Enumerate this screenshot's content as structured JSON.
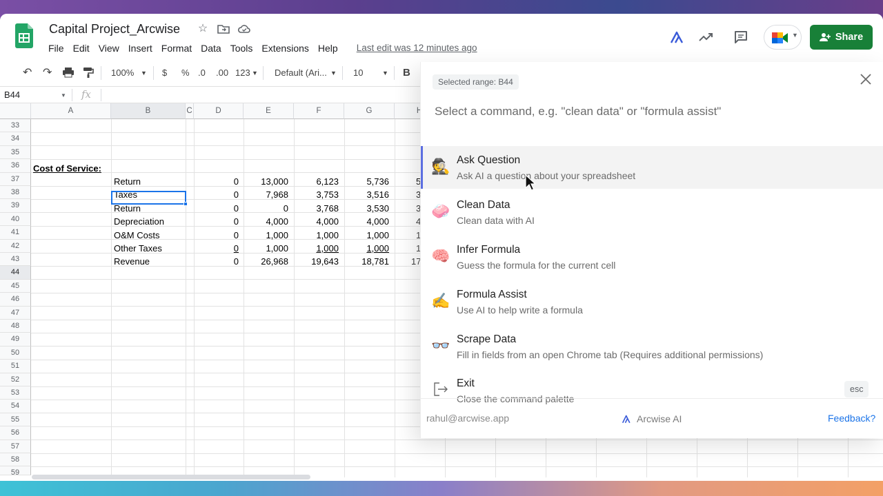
{
  "doc": {
    "title": "Capital Project_Arcwise",
    "last_edit": "Last edit was 12 minutes ago",
    "share_label": "Share",
    "menus": [
      "File",
      "Edit",
      "View",
      "Insert",
      "Format",
      "Data",
      "Tools",
      "Extensions",
      "Help"
    ]
  },
  "toolbar": {
    "zoom": "100%",
    "currency": "$",
    "percent": "%",
    "dec_less": ".0",
    "dec_more": ".00",
    "num_format": "123",
    "font": "Default (Ari...",
    "font_size": "10",
    "bold": "B"
  },
  "formula_bar": {
    "name_box": "B44",
    "fx": "fx"
  },
  "grid": {
    "columns": [
      "A",
      "B",
      "C",
      "D",
      "E",
      "F",
      "G",
      "H"
    ],
    "rows": [
      "33",
      "34",
      "35",
      "36",
      "37",
      "38",
      "39",
      "40",
      "41",
      "42",
      "43",
      "44",
      "45",
      "46",
      "47",
      "48",
      "49",
      "50",
      "51",
      "52",
      "53",
      "54",
      "55",
      "56",
      "57",
      "58",
      "59"
    ],
    "section_label": "Cost of Service:",
    "data_rows": [
      {
        "label": "Return",
        "d": "0",
        "e": "13,000",
        "f": "6,123",
        "g": "5,736",
        "h": "5"
      },
      {
        "label": "Taxes",
        "d": "0",
        "e": "7,968",
        "f": "3,753",
        "g": "3,516",
        "h": "3"
      },
      {
        "label": "Return",
        "d": "0",
        "e": "0",
        "f": "3,768",
        "g": "3,530",
        "h": "3"
      },
      {
        "label": "Depreciation",
        "d": "0",
        "e": "4,000",
        "f": "4,000",
        "g": "4,000",
        "h": "4"
      },
      {
        "label": "O&M Costs",
        "d": "0",
        "e": "1,000",
        "f": "1,000",
        "g": "1,000",
        "h": "1"
      },
      {
        "label": "Other Taxes",
        "d": "0",
        "e": "1,000",
        "f": "1,000",
        "g": "1,000",
        "h": "1"
      },
      {
        "label": "Revenue",
        "d": "0",
        "e": "26,968",
        "f": "19,643",
        "g": "18,781",
        "h": "17"
      }
    ]
  },
  "palette": {
    "selected_range": "Selected range: B44",
    "placeholder": "Select a command, e.g. \"clean data\" or \"formula assist\"",
    "items": [
      {
        "emoji": "🕵️",
        "title": "Ask Question",
        "desc": "Ask AI a question about your spreadsheet"
      },
      {
        "emoji": "🧼",
        "title": "Clean Data",
        "desc": "Clean data with AI"
      },
      {
        "emoji": "🧠",
        "title": "Infer Formula",
        "desc": "Guess the formula for the current cell"
      },
      {
        "emoji": "✍️",
        "title": "Formula Assist",
        "desc": "Use AI to help write a formula"
      },
      {
        "emoji": "👓",
        "title": "Scrape Data",
        "desc": "Fill in fields from an open Chrome tab (Requires additional permissions)"
      },
      {
        "emoji": "",
        "title": "Exit",
        "desc": "Close the command palette"
      }
    ],
    "esc_label": "esc",
    "footer_email": "rahul@arcwise.app",
    "footer_brand": "Arcwise AI",
    "footer_feedback": "Feedback?"
  },
  "colors": {
    "accent": "#1a73e8",
    "share_green": "#188038",
    "active_bar": "#5b6ee1"
  }
}
